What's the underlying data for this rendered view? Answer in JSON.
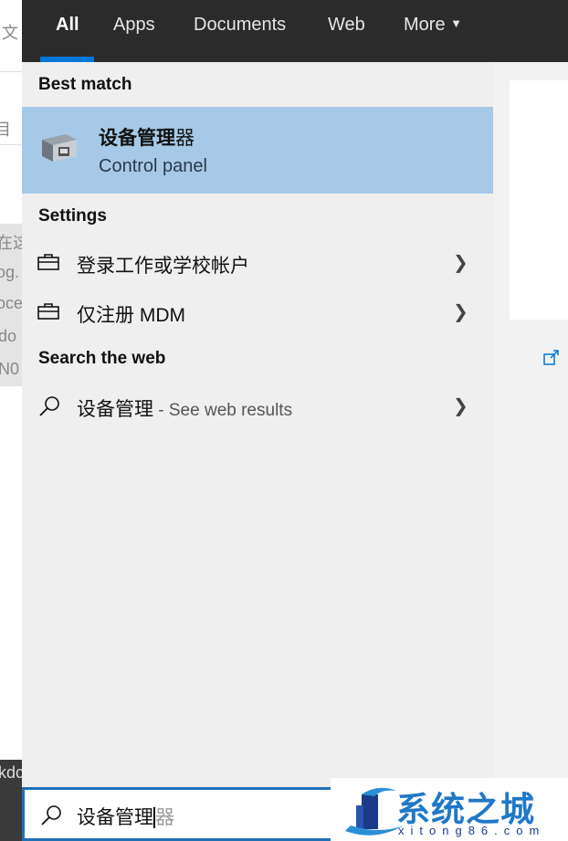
{
  "background_fragments": [
    "文",
    "目",
    "在这",
    "og.",
    "oce",
    "do",
    "N0",
    "kdc"
  ],
  "tabs": [
    {
      "label": "All"
    },
    {
      "label": "Apps"
    },
    {
      "label": "Documents"
    },
    {
      "label": "Web"
    },
    {
      "label": "More"
    }
  ],
  "best_match": {
    "heading": "Best match",
    "title_bold": "设备管理",
    "title_rest": "器",
    "subtitle": "Control panel",
    "icon": "device-manager-icon"
  },
  "settings": {
    "heading": "Settings",
    "items": [
      {
        "label": "登录工作或学校帐户",
        "icon": "briefcase-icon"
      },
      {
        "label": "仅注册 MDM",
        "icon": "briefcase-icon"
      }
    ]
  },
  "web": {
    "heading": "Search the web",
    "query": "设备管理",
    "suffix": " - See web results"
  },
  "search": {
    "typed": "设备管理",
    "suggestion": "器"
  },
  "watermark": {
    "name": "系统之城",
    "url": "xitong86.com"
  },
  "colors": {
    "accent": "#0078d7",
    "selection": "#a7c9e8",
    "header": "#2b2b2b"
  }
}
